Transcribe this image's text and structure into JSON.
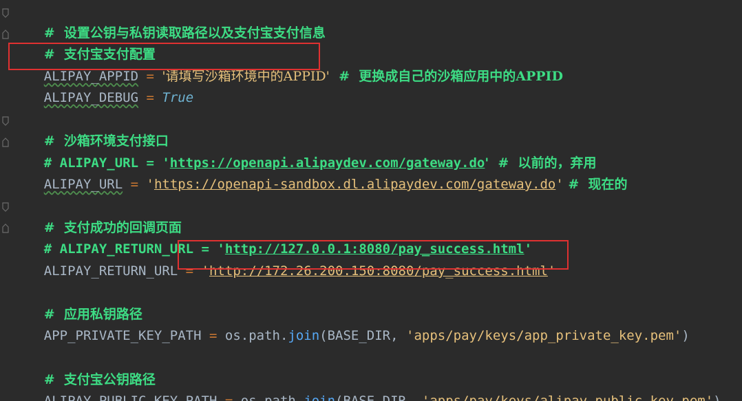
{
  "lines": {
    "l1": {
      "comment": "#  设置公钥与私钥读取路径以及支付宝支付信息"
    },
    "l2": {
      "comment": "#  支付宝支付配置"
    },
    "l3": {
      "name": "ALIPAY_APPID",
      "eq": " = ",
      "value": "'请填写沙箱环境中的APPID'",
      "comment": "  #  更换成自己的沙箱应用中的APPID"
    },
    "l4": {
      "name": "ALIPAY_DEBUG",
      "eq": " = ",
      "value": "True"
    },
    "l6": {
      "comment": "#  沙箱环境支付接口"
    },
    "l7": {
      "prefix": "# ALIPAY_URL = '",
      "url": "https://openapi.alipaydev.com/gateway.do",
      "suffix": "'  #  以前的，弃用"
    },
    "l8": {
      "name": "ALIPAY_URL",
      "eq": " = ",
      "q1": "'",
      "url": "https://openapi-sandbox.dl.alipaydev.com/gateway.do",
      "q2": "'",
      "comment": " #  现在的"
    },
    "l10": {
      "comment": "#  支付成功的回调页面"
    },
    "l11": {
      "prefix": "# ALIPAY_RETURN_URL = '",
      "url": "http://127.0.0.1:8080/pay_success.html",
      "suffix": "'"
    },
    "l12": {
      "name": "ALIPAY_RETURN_URL",
      "eq": " = ",
      "q1": "'",
      "url": "http://172.26.200.150:8080/pay_success.html",
      "q2": "'"
    },
    "l14": {
      "comment": "#  应用私钥路径"
    },
    "l15": {
      "name": "APP_PRIVATE_KEY_PATH",
      "eq": " = ",
      "call": "os.path.",
      "fn": "join",
      "open": "(BASE_DIR, ",
      "arg": "'apps/pay/keys/app_private_key.pem'",
      "close": ")"
    },
    "l17": {
      "comment": "#  支付宝公钥路径"
    },
    "l18": {
      "name": "ALIPAY_PUBLIC_KEY_PATH",
      "eq": " = ",
      "call": "os.path.",
      "fn": "join",
      "open": "(BASE_DIR, ",
      "arg": "'apps/pay/keys/alipay_public_key.pem'",
      "close": ")"
    }
  },
  "colors": {
    "background": "#2b2b2b",
    "comment": "#3ddc84",
    "string": "#e6c07b",
    "keyword": "#6fb3d2",
    "operator": "#cc7832",
    "highlight_box": "#e03131"
  }
}
